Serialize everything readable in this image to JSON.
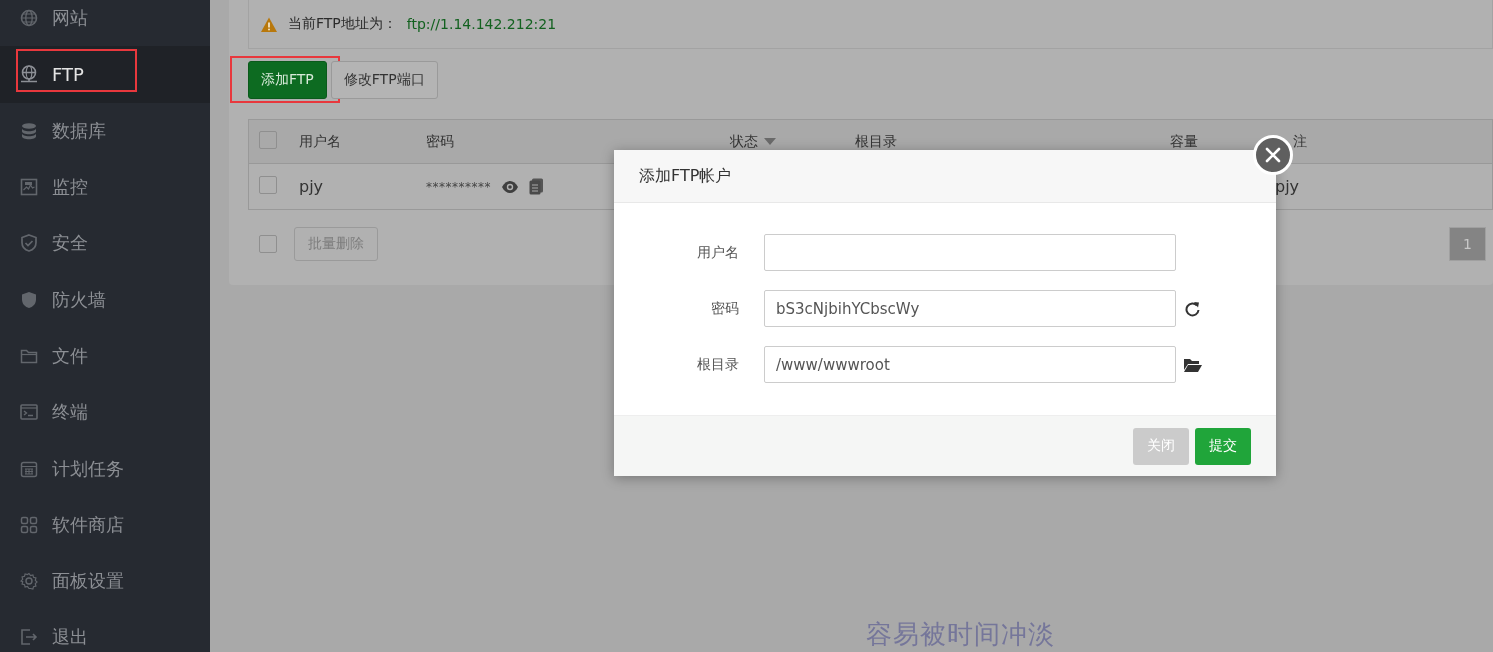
{
  "sidebar": {
    "items": [
      {
        "label": "网站",
        "selected": false,
        "highlighted": false
      },
      {
        "label": "FTP",
        "selected": true,
        "highlighted": true
      },
      {
        "label": "数据库",
        "selected": false,
        "highlighted": false
      },
      {
        "label": "监控",
        "selected": false,
        "highlighted": false
      },
      {
        "label": "安全",
        "selected": false,
        "highlighted": false
      },
      {
        "label": "防火墙",
        "selected": false,
        "highlighted": false
      },
      {
        "label": "文件",
        "selected": false,
        "highlighted": false
      },
      {
        "label": "终端",
        "selected": false,
        "highlighted": false
      },
      {
        "label": "计划任务",
        "selected": false,
        "highlighted": false
      },
      {
        "label": "软件商店",
        "selected": false,
        "highlighted": false
      },
      {
        "label": "面板设置",
        "selected": false,
        "highlighted": false
      },
      {
        "label": "退出",
        "selected": false,
        "highlighted": false
      }
    ]
  },
  "notice": {
    "text": "当前FTP地址为：",
    "address": "ftp://1.14.142.212:21"
  },
  "toolbar": {
    "buttons": [
      {
        "label": "添加FTP",
        "kind": "primary",
        "highlighted": true
      },
      {
        "label": "修改FTP端口",
        "kind": "default",
        "highlighted": false
      }
    ]
  },
  "table": {
    "select_all": {
      "checked": false
    },
    "columns": [
      {
        "label": "用户名",
        "sortable": false
      },
      {
        "label": "密码",
        "sortable": false
      },
      {
        "label": "状态",
        "sortable": true
      },
      {
        "label": "根目录",
        "sortable": false
      },
      {
        "label": "容量",
        "sortable": false
      },
      {
        "label": "注",
        "sortable": false
      }
    ],
    "rows": [
      {
        "checked": false,
        "username": "pjy",
        "password": "**********",
        "remark": "pjy"
      }
    ]
  },
  "table_footer": {
    "checked": false,
    "batch_button": "批量删除",
    "pages": [
      {
        "label": "1",
        "selected": true
      }
    ]
  },
  "modal": {
    "title": "添加FTP帐户",
    "fields": [
      {
        "label": "用户名",
        "kind": "text"
      },
      {
        "label": "密码",
        "kind": "password",
        "value": "bS3cNjbihYCbscWy"
      },
      {
        "label": "根目录",
        "kind": "path",
        "value": "/www/wwwroot"
      }
    ],
    "buttons": [
      {
        "label": "关闭",
        "kind": "secondary"
      },
      {
        "label": "提交",
        "kind": "primary"
      }
    ]
  },
  "caption": "容易被时间冲淡"
}
